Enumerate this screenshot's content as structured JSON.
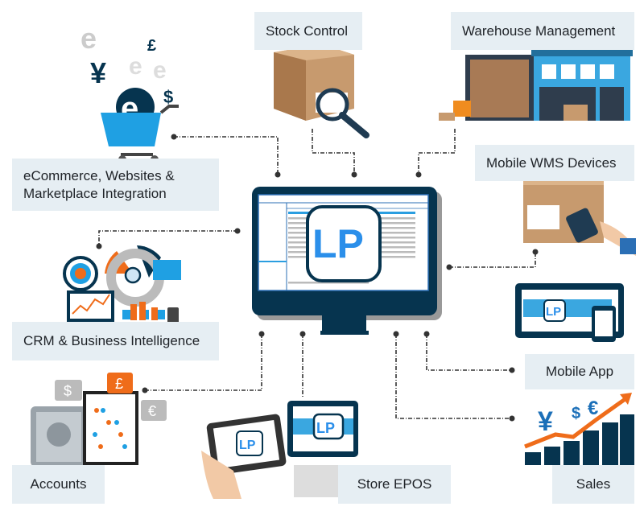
{
  "colors": {
    "navy": "#06344f",
    "blue": "#2b8fea",
    "orange": "#ef6c1a",
    "label_bg": "#e6eef3",
    "connector": "#333333"
  },
  "center": {
    "logo": "LP"
  },
  "labels": {
    "stock": "Stock Control",
    "warehouse": "Warehouse Management",
    "ecommerce_1": "eCommerce, Websites &",
    "ecommerce_2": "Marketplace Integration",
    "mobile_wms": "Mobile WMS Devices",
    "crm": "CRM & Business Intelligence",
    "mobile_app": "Mobile App",
    "accounts": "Accounts",
    "epos": "Store EPOS",
    "sales": "Sales"
  },
  "symbols": {
    "yen": "¥",
    "pound": "£",
    "dollar": "$",
    "euro": "€",
    "e": "e"
  }
}
